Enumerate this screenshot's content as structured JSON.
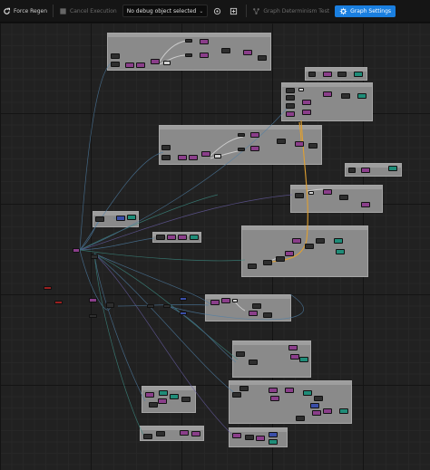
{
  "toolbar": {
    "force_regen": "Force Regen",
    "cancel_execution": "Cancel Execution",
    "debug_object": "No debug object selected",
    "graph_determinism_test": "Graph Determinism Test",
    "graph_settings": "Graph Settings"
  },
  "icons": {
    "force_regen": "refresh-icon",
    "cancel_execution": "stop-icon",
    "debug_find": "target-icon",
    "debug_browse": "browse-icon",
    "determinism": "graph-icon",
    "settings": "settings-icon"
  },
  "colors": {
    "accent": "#1a7fe0",
    "comment_box": "#8a8a8a",
    "node_purple": "#8a3e8a",
    "node_teal": "#1f8c78",
    "wire_orange": "#e0a030",
    "wire_blue": "#4f7fa6"
  }
}
